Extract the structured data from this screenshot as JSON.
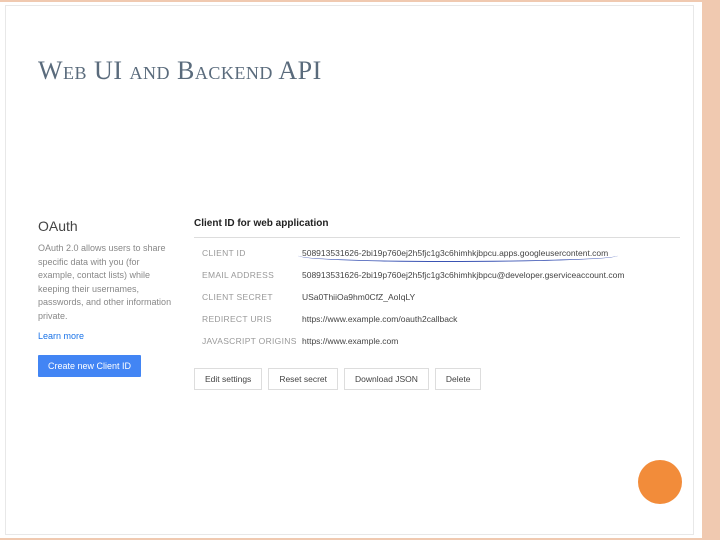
{
  "title": "Web UI and Backend API",
  "sidebar": {
    "heading": "OAuth",
    "description": "OAuth 2.0 allows users to share specific data with you (for example, contact lists) while keeping their usernames, passwords, and other information private.",
    "learn_more": "Learn more",
    "create_button": "Create new Client ID"
  },
  "details": {
    "heading": "Client ID for web application",
    "rows": [
      {
        "label": "CLIENT ID",
        "value": "508913531626-2bi19p760ej2h5fjc1g3c6himhkjbpcu.apps.googleusercontent.com",
        "underline": true
      },
      {
        "label": "EMAIL ADDRESS",
        "value": "508913531626-2bi19p760ej2h5fjc1g3c6himhkjbpcu@developer.gserviceaccount.com"
      },
      {
        "label": "CLIENT SECRET",
        "value": "USa0ThiiOa9hm0CfZ_AoIqLY"
      },
      {
        "label": "REDIRECT URIS",
        "value": "https://www.example.com/oauth2callback"
      },
      {
        "label": "JAVASCRIPT ORIGINS",
        "value": "https://www.example.com"
      }
    ],
    "buttons": {
      "edit": "Edit settings",
      "reset": "Reset secret",
      "download": "Download JSON",
      "delete": "Delete"
    }
  }
}
